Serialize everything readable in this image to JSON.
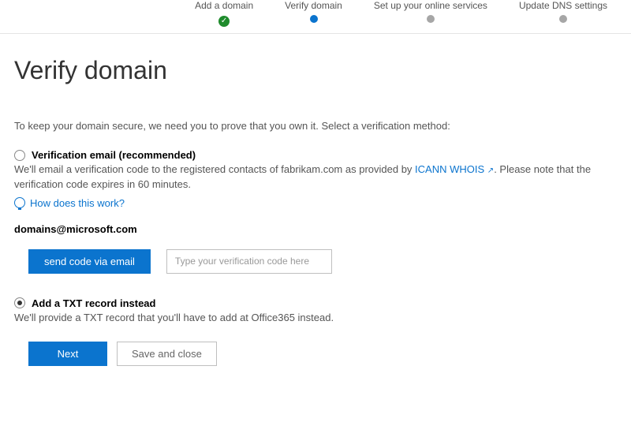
{
  "stepper": {
    "step1": "Add a domain",
    "step2": "Verify domain",
    "step3": "Set up your online services",
    "step4": "Update DNS settings"
  },
  "heading": "Verify domain",
  "intro": "To keep your domain secure, we need you to prove that you own it. Select a verification method:",
  "opt1": {
    "title": "Verification email (recommended)",
    "desc_a": "We'll email a verification code to the registered contacts of fabrikam.com as provided by ",
    "whois_link": "ICANN WHOIS",
    "ext": "↗",
    "desc_b": ". Please note that the verification code expires in 60 minutes.",
    "help": "How does this work?",
    "email": "domains@microsoft.com",
    "send_btn": "send code via email",
    "code_placeholder": "Type your verification code here"
  },
  "opt2": {
    "title": "Add a TXT record instead",
    "desc": "We'll provide a TXT record that you'll have to add at Office365 instead."
  },
  "footer": {
    "next": "Next",
    "save": "Save and close"
  }
}
